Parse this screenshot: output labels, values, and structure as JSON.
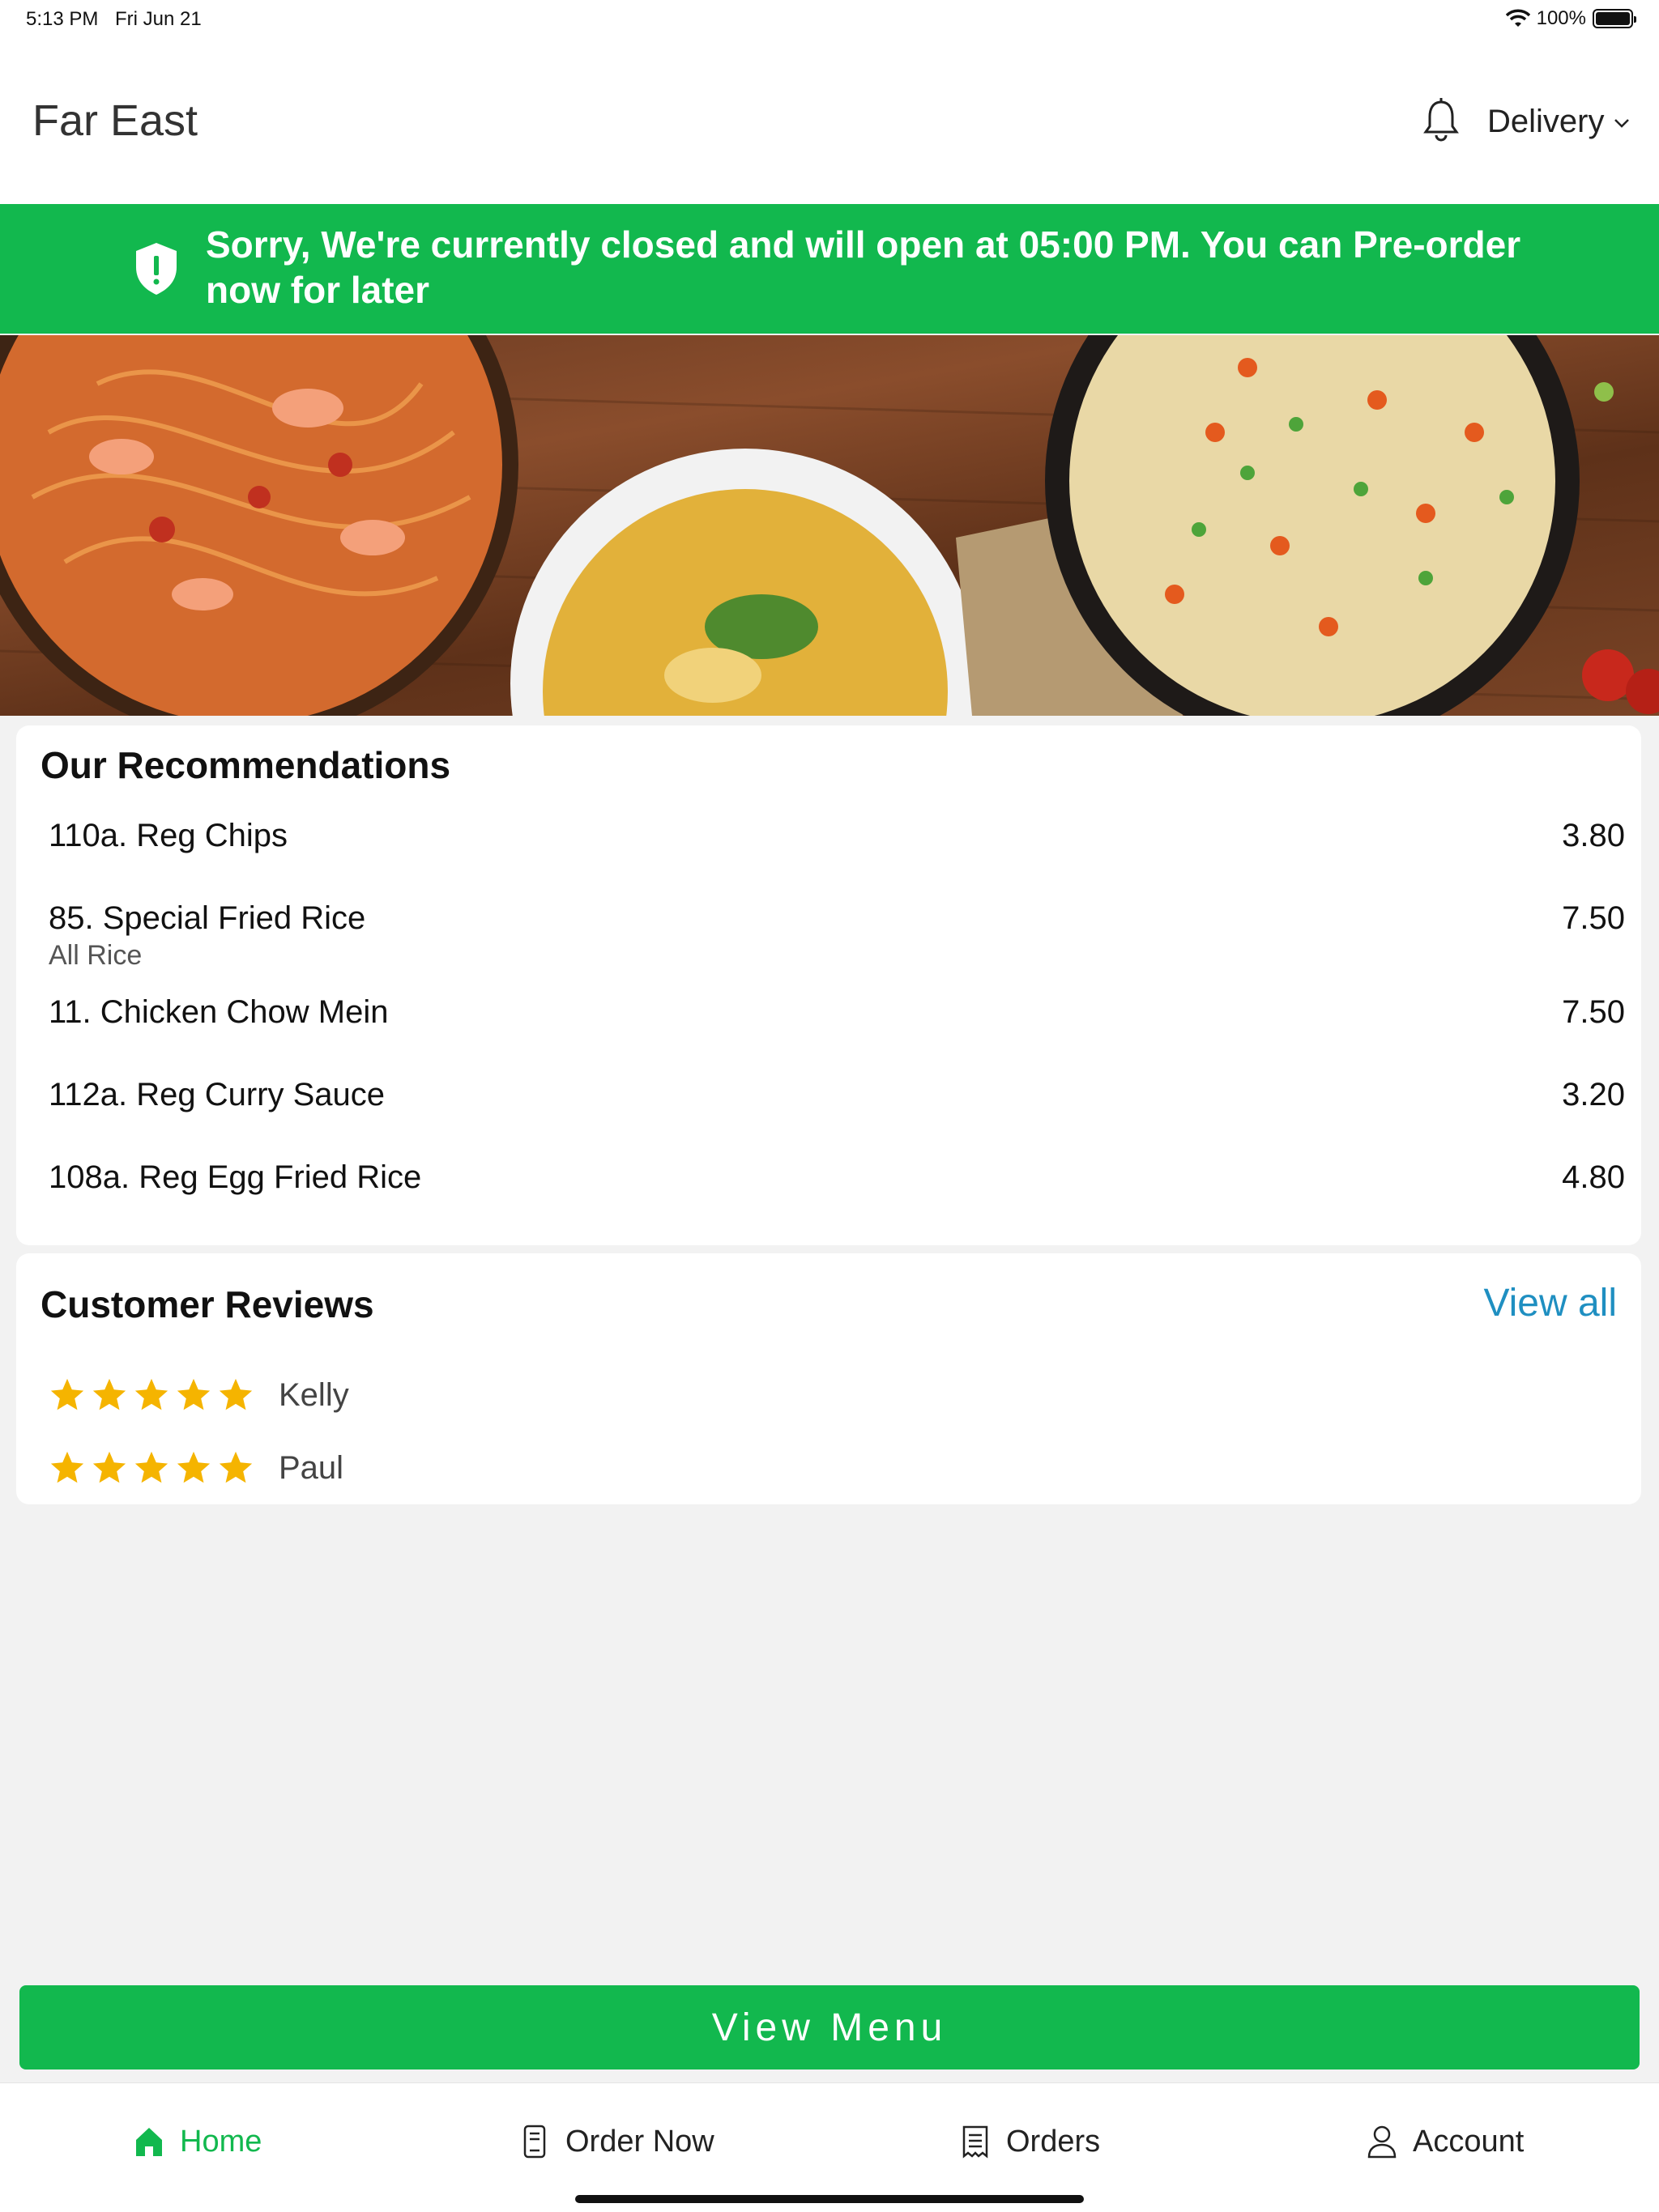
{
  "status_bar": {
    "time": "5:13 PM",
    "date": "Fri Jun 21",
    "battery": "100%"
  },
  "header": {
    "title": "Far East",
    "mode": "Delivery",
    "icons": [
      "bell-icon",
      "chevron-down-icon"
    ]
  },
  "banner": {
    "message": "Sorry, We're currently closed and will open at 05:00 PM. You can Pre-order now for later",
    "icon": "shield-alert-icon",
    "color": "#12b84e"
  },
  "recommendations": {
    "title": "Our Recommendations",
    "items": [
      {
        "name": "110a. Reg Chips",
        "category": "",
        "price": "3.80"
      },
      {
        "name": "85. Special Fried Rice",
        "category": "All Rice",
        "price": "7.50"
      },
      {
        "name": "11. Chicken Chow Mein",
        "category": "",
        "price": "7.50"
      },
      {
        "name": "112a. Reg Curry Sauce",
        "category": "",
        "price": "3.20"
      },
      {
        "name": "108a. Reg Egg Fried Rice",
        "category": "",
        "price": "4.80"
      }
    ]
  },
  "reviews": {
    "title": "Customer Reviews",
    "view_all": "View all",
    "items": [
      {
        "name": "Kelly",
        "rating": 5
      },
      {
        "name": "Paul",
        "rating": 5
      }
    ],
    "star_color": "#f5b400"
  },
  "actions": {
    "view_menu": "View Menu"
  },
  "tabs": [
    {
      "label": "Home",
      "icon": "home-icon",
      "active": true
    },
    {
      "label": "Order Now",
      "icon": "order-icon",
      "active": false
    },
    {
      "label": "Orders",
      "icon": "receipt-icon",
      "active": false
    },
    {
      "label": "Account",
      "icon": "user-icon",
      "active": false
    }
  ],
  "colors": {
    "accent": "#12b84e",
    "link": "#1f8fc1"
  }
}
